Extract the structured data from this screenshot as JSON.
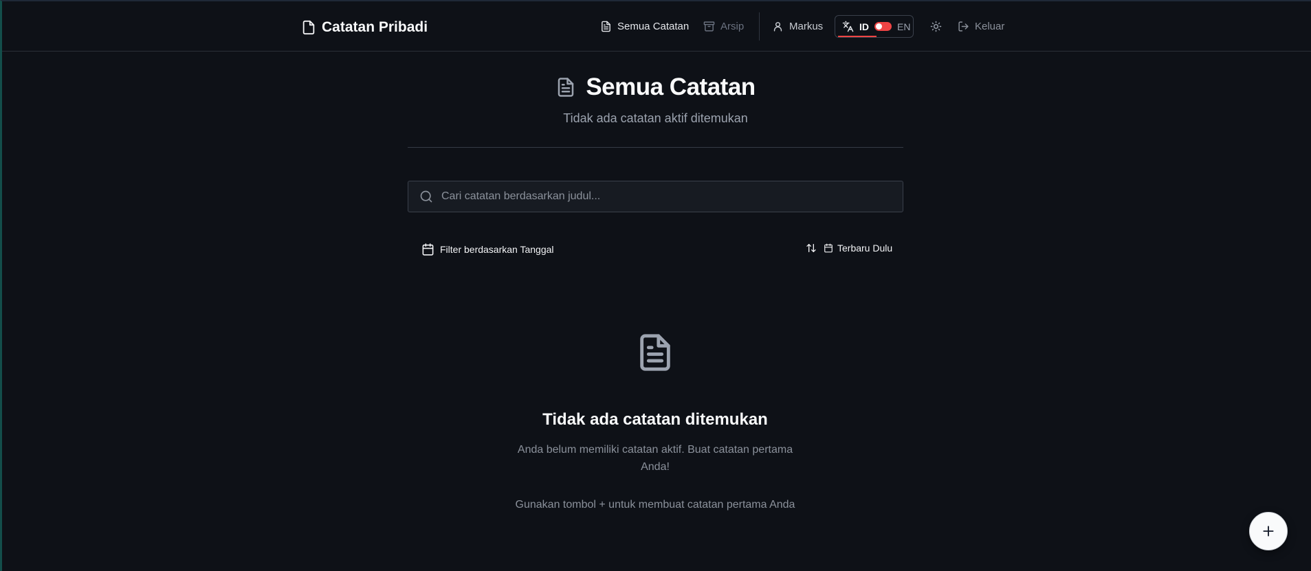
{
  "app": {
    "brand": "Catatan Pribadi",
    "brand_icon": "file-icon"
  },
  "nav": {
    "all_notes": "Semua Catatan",
    "archive": "Arsip",
    "user": "Markus",
    "lang_id": "ID",
    "lang_en": "EN",
    "logout": "Keluar"
  },
  "page": {
    "title": "Semua Catatan",
    "subtitle": "Tidak ada catatan aktif ditemukan"
  },
  "search": {
    "placeholder": "Cari catatan berdasarkan judul...",
    "value": ""
  },
  "filter": {
    "date_label": "Filter berdasarkan Tanggal",
    "sort_label": "Terbaru Dulu"
  },
  "empty": {
    "title": "Tidak ada catatan ditemukan",
    "description": "Anda belum memiliki catatan aktif. Buat catatan pertama Anda!",
    "hint": "Gunakan tombol + untuk membuat catatan pertama Anda"
  },
  "colors": {
    "background": "#0e1117",
    "accent": "#ef4444",
    "text": "#f9fafb",
    "muted": "#8b919b"
  }
}
